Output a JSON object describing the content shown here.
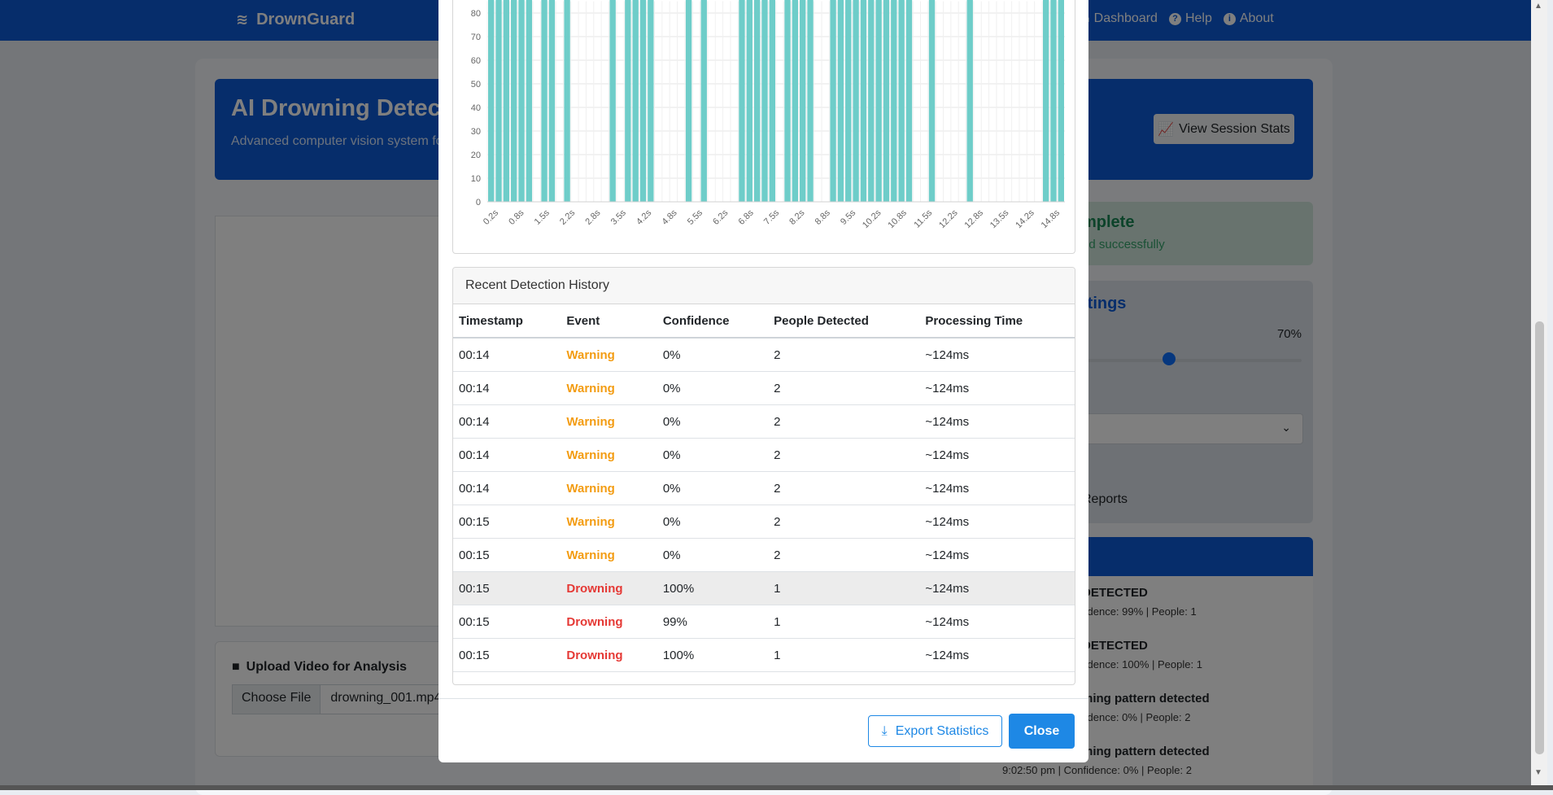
{
  "navbar": {
    "brand": "DrownGuard",
    "links": [
      {
        "label": "Dashboard",
        "icon": "home-icon"
      },
      {
        "label": "Help",
        "icon": "question-icon"
      },
      {
        "label": "About",
        "icon": "info-icon"
      }
    ]
  },
  "hero": {
    "title": "AI Drowning Detec",
    "subtitle": "Advanced computer vision system for",
    "stats_button": "View Session Stats"
  },
  "upload": {
    "title": "Upload Video for Analysis",
    "choose_label": "Choose File",
    "file_name": "drowning_001.mp4"
  },
  "status": {
    "title": "mplete",
    "subtitle": "ed successfully"
  },
  "settings": {
    "title": "ttings",
    "threshold_label": "d",
    "threshold_value": "70%",
    "threshold_level": 0.7,
    "reports_label": "Reports"
  },
  "alerts": [
    {
      "title": "DETECTED",
      "detail": "fidence: 99% | People: 1"
    },
    {
      "title": "DETECTED",
      "detail": "fidence: 100% | People: 1"
    },
    {
      "title": "ming pattern detected",
      "detail": "fidence: 0% | People: 2"
    },
    {
      "title": "ming pattern detected",
      "detail": "9:02:50 pm | Confidence: 0% | People: 2"
    }
  ],
  "chart_data": {
    "type": "bar",
    "title": "",
    "xlabel": "",
    "ylabel": "",
    "ylim": [
      0,
      85
    ],
    "yticks": [
      0,
      10,
      20,
      30,
      40,
      50,
      60,
      70,
      80
    ],
    "tick_labels": [
      "0.2s",
      "0.8s",
      "1.5s",
      "2.2s",
      "2.8s",
      "3.5s",
      "4.2s",
      "4.8s",
      "5.5s",
      "6.2s",
      "6.8s",
      "7.5s",
      "8.2s",
      "8.8s",
      "9.5s",
      "10.2s",
      "10.8s",
      "11.5s",
      "12.2s",
      "12.8s",
      "13.5s",
      "14.2s",
      "14.8s"
    ],
    "grid": true,
    "bar_color": "#6ecdc9",
    "values": [
      100,
      100,
      100,
      100,
      100,
      100,
      0,
      100,
      100,
      0,
      100,
      0,
      0,
      0,
      0,
      0,
      100,
      0,
      100,
      100,
      100,
      100,
      0,
      0,
      0,
      0,
      100,
      0,
      100,
      0,
      0,
      0,
      0,
      100,
      100,
      100,
      100,
      100,
      0,
      100,
      100,
      100,
      100,
      0,
      0,
      100,
      100,
      100,
      100,
      100,
      100,
      100,
      100,
      100,
      100,
      100,
      0,
      0,
      100,
      0,
      0,
      0,
      0,
      100,
      0,
      0,
      0,
      0,
      0,
      0,
      0,
      0,
      0,
      100,
      100,
      100
    ],
    "note": "values are confidence (%) per frame; bars extend beyond the visible 85 top of the cropped view"
  },
  "history": {
    "title": "Recent Detection History",
    "columns": [
      "Timestamp",
      "Event",
      "Confidence",
      "People Detected",
      "Processing Time"
    ],
    "rows": [
      {
        "time": "00:14",
        "event": "Warning",
        "confidence": "0%",
        "people": "2",
        "proc": "~124ms"
      },
      {
        "time": "00:14",
        "event": "Warning",
        "confidence": "0%",
        "people": "2",
        "proc": "~124ms"
      },
      {
        "time": "00:14",
        "event": "Warning",
        "confidence": "0%",
        "people": "2",
        "proc": "~124ms"
      },
      {
        "time": "00:14",
        "event": "Warning",
        "confidence": "0%",
        "people": "2",
        "proc": "~124ms"
      },
      {
        "time": "00:14",
        "event": "Warning",
        "confidence": "0%",
        "people": "2",
        "proc": "~124ms"
      },
      {
        "time": "00:15",
        "event": "Warning",
        "confidence": "0%",
        "people": "2",
        "proc": "~124ms"
      },
      {
        "time": "00:15",
        "event": "Warning",
        "confidence": "0%",
        "people": "2",
        "proc": "~124ms"
      },
      {
        "time": "00:15",
        "event": "Drowning",
        "confidence": "100%",
        "people": "1",
        "proc": "~124ms"
      },
      {
        "time": "00:15",
        "event": "Drowning",
        "confidence": "99%",
        "people": "1",
        "proc": "~124ms"
      },
      {
        "time": "00:15",
        "event": "Drowning",
        "confidence": "100%",
        "people": "1",
        "proc": "~124ms"
      }
    ]
  },
  "footer": {
    "export_label": "Export Statistics",
    "close_label": "Close"
  }
}
